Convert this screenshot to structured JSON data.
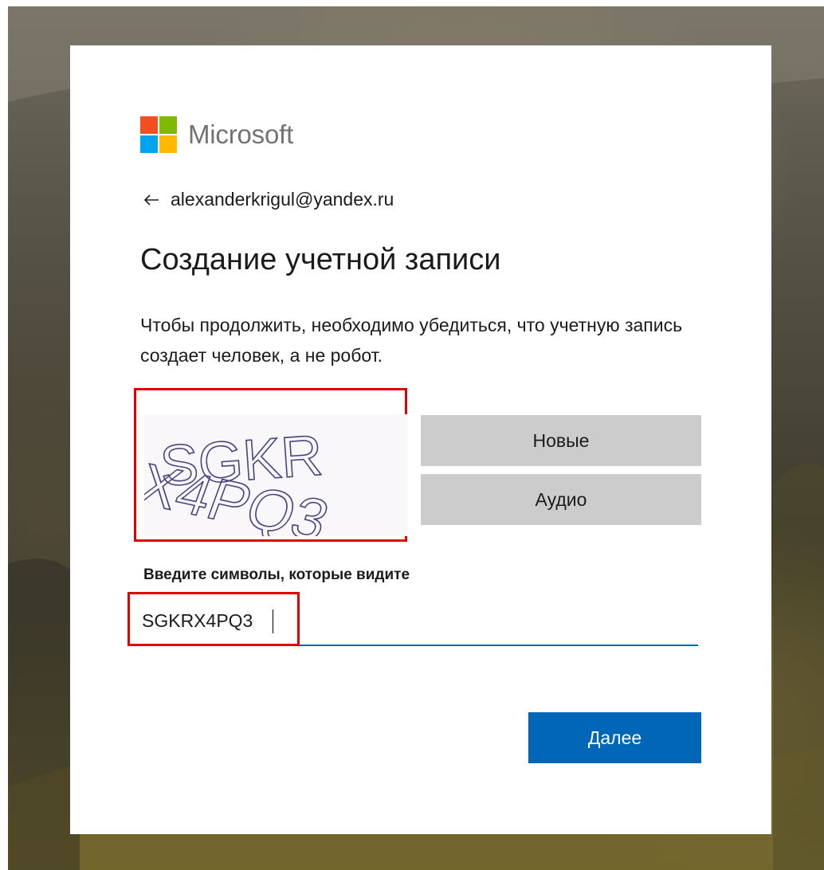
{
  "brand": {
    "name": "Microsoft",
    "colors": {
      "red": "#f25022",
      "green": "#7fba00",
      "blue": "#00a4ef",
      "yellow": "#ffb900"
    }
  },
  "identity": {
    "email": "alexanderkrigul@yandex.ru",
    "back_icon": "back-arrow-icon"
  },
  "page": {
    "title": "Создание учетной записи",
    "description": "Чтобы продолжить, необходимо убедиться, что учетную запись создает человек, а не робот."
  },
  "captcha": {
    "image_text": "SGKR X4PQ3",
    "new_label": "Новые",
    "audio_label": "Аудио"
  },
  "input": {
    "label": "Введите символы, которые видите",
    "value": "SGKRX4PQ3"
  },
  "actions": {
    "next_label": "Далее"
  },
  "colors": {
    "accent": "#0067b8",
    "highlight": "#e00000",
    "captcha_button_bg": "#cccccc"
  }
}
